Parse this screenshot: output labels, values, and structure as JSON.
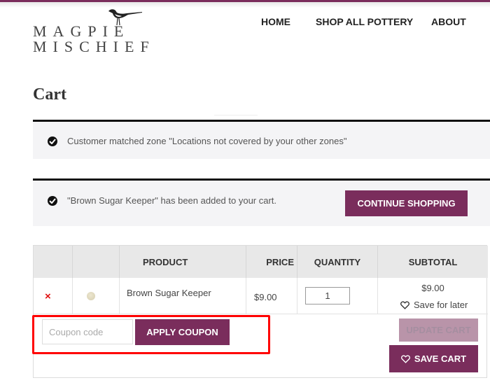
{
  "brand": {
    "logo_line1": "MAGPIE",
    "logo_line2": "MISCHIEF",
    "accent_color": "#7a2d5c",
    "logo_icon": "magpie-bird-icon"
  },
  "nav": {
    "items": [
      {
        "label": "HOME"
      },
      {
        "label": "SHOP ALL POTTERY"
      },
      {
        "label": "ABOUT"
      }
    ]
  },
  "page": {
    "title": "Cart"
  },
  "notices": [
    {
      "icon": "check-circle-icon",
      "message": "Customer matched zone \"Locations not covered by your other zones\""
    },
    {
      "icon": "check-circle-icon",
      "message": "\"Brown Sugar Keeper\" has been added to your cart.",
      "button_label": "CONTINUE SHOPPING"
    }
  ],
  "cart": {
    "columns": [
      "",
      "",
      "PRODUCT",
      "PRICE",
      "QUANTITY",
      "SUBTOTAL"
    ],
    "rows": [
      {
        "remove_icon": "×",
        "product": "Brown Sugar Keeper",
        "price": "$9.00",
        "quantity": "1",
        "subtotal": "$9.00",
        "save_for_later": "Save for later"
      }
    ],
    "coupon_placeholder": "Coupon code",
    "apply_coupon_label": "APPLY COUPON",
    "update_cart_label": "UPDATE CART",
    "save_cart_label": "SAVE CART"
  }
}
